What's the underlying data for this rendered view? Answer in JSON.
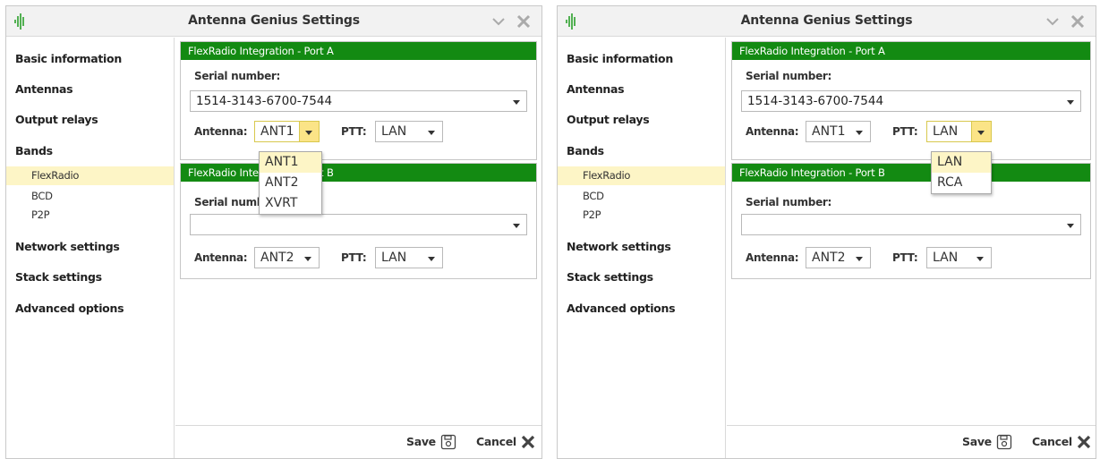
{
  "windows": [
    {
      "title": "Antenna Genius Settings",
      "sidebar": {
        "items": [
          {
            "label": "Basic information"
          },
          {
            "label": "Antennas"
          },
          {
            "label": "Output relays"
          },
          {
            "label": "Bands"
          },
          {
            "label": "FlexRadio",
            "selected": true
          },
          {
            "label": "BCD"
          },
          {
            "label": "P2P"
          },
          {
            "label": "Network settings"
          },
          {
            "label": "Stack settings"
          },
          {
            "label": "Advanced options"
          }
        ]
      },
      "port_a": {
        "header": "FlexRadio Integration - Port A",
        "serial_label": "Serial number:",
        "serial_value": "1514-3143-6700-7544",
        "antenna_label": "Antenna:",
        "antenna_value": "ANT1",
        "ptt_label": "PTT:",
        "ptt_value": "LAN"
      },
      "port_b": {
        "header": "FlexRadio Integration - Port B",
        "serial_label": "Serial number:",
        "serial_value": "",
        "antenna_label": "Antenna:",
        "antenna_value": "ANT2",
        "ptt_label": "PTT:",
        "ptt_value": "LAN"
      },
      "dropdown": {
        "for": "antenna",
        "options": [
          "ANT1",
          "ANT2",
          "XVRT"
        ],
        "highlighted": "ANT1"
      },
      "footer": {
        "save": "Save",
        "cancel": "Cancel"
      }
    },
    {
      "title": "Antenna Genius Settings",
      "sidebar": {
        "items": [
          {
            "label": "Basic information"
          },
          {
            "label": "Antennas"
          },
          {
            "label": "Output relays"
          },
          {
            "label": "Bands"
          },
          {
            "label": "FlexRadio",
            "selected": true
          },
          {
            "label": "BCD"
          },
          {
            "label": "P2P"
          },
          {
            "label": "Network settings"
          },
          {
            "label": "Stack settings"
          },
          {
            "label": "Advanced options"
          }
        ]
      },
      "port_a": {
        "header": "FlexRadio Integration - Port A",
        "serial_label": "Serial number:",
        "serial_value": "1514-3143-6700-7544",
        "antenna_label": "Antenna:",
        "antenna_value": "ANT1",
        "ptt_label": "PTT:",
        "ptt_value": "LAN"
      },
      "port_b": {
        "header": "FlexRadio Integration - Port B",
        "serial_label": "Serial number:",
        "serial_value": "",
        "antenna_label": "Antenna:",
        "antenna_value": "ANT2",
        "ptt_label": "PTT:",
        "ptt_value": "LAN"
      },
      "dropdown": {
        "for": "ptt",
        "options": [
          "LAN",
          "RCA"
        ],
        "highlighted": "LAN"
      },
      "footer": {
        "save": "Save",
        "cancel": "Cancel"
      }
    }
  ],
  "colors": {
    "group_header": "#138a12",
    "selected_item": "#fdf5c6",
    "open_combo_button": "#fbe487"
  },
  "icons": [
    "antenna-genius-logo-icon",
    "chevron-down-icon",
    "close-icon",
    "save-icon",
    "cancel-icon",
    "dropdown-arrow-icon"
  ]
}
